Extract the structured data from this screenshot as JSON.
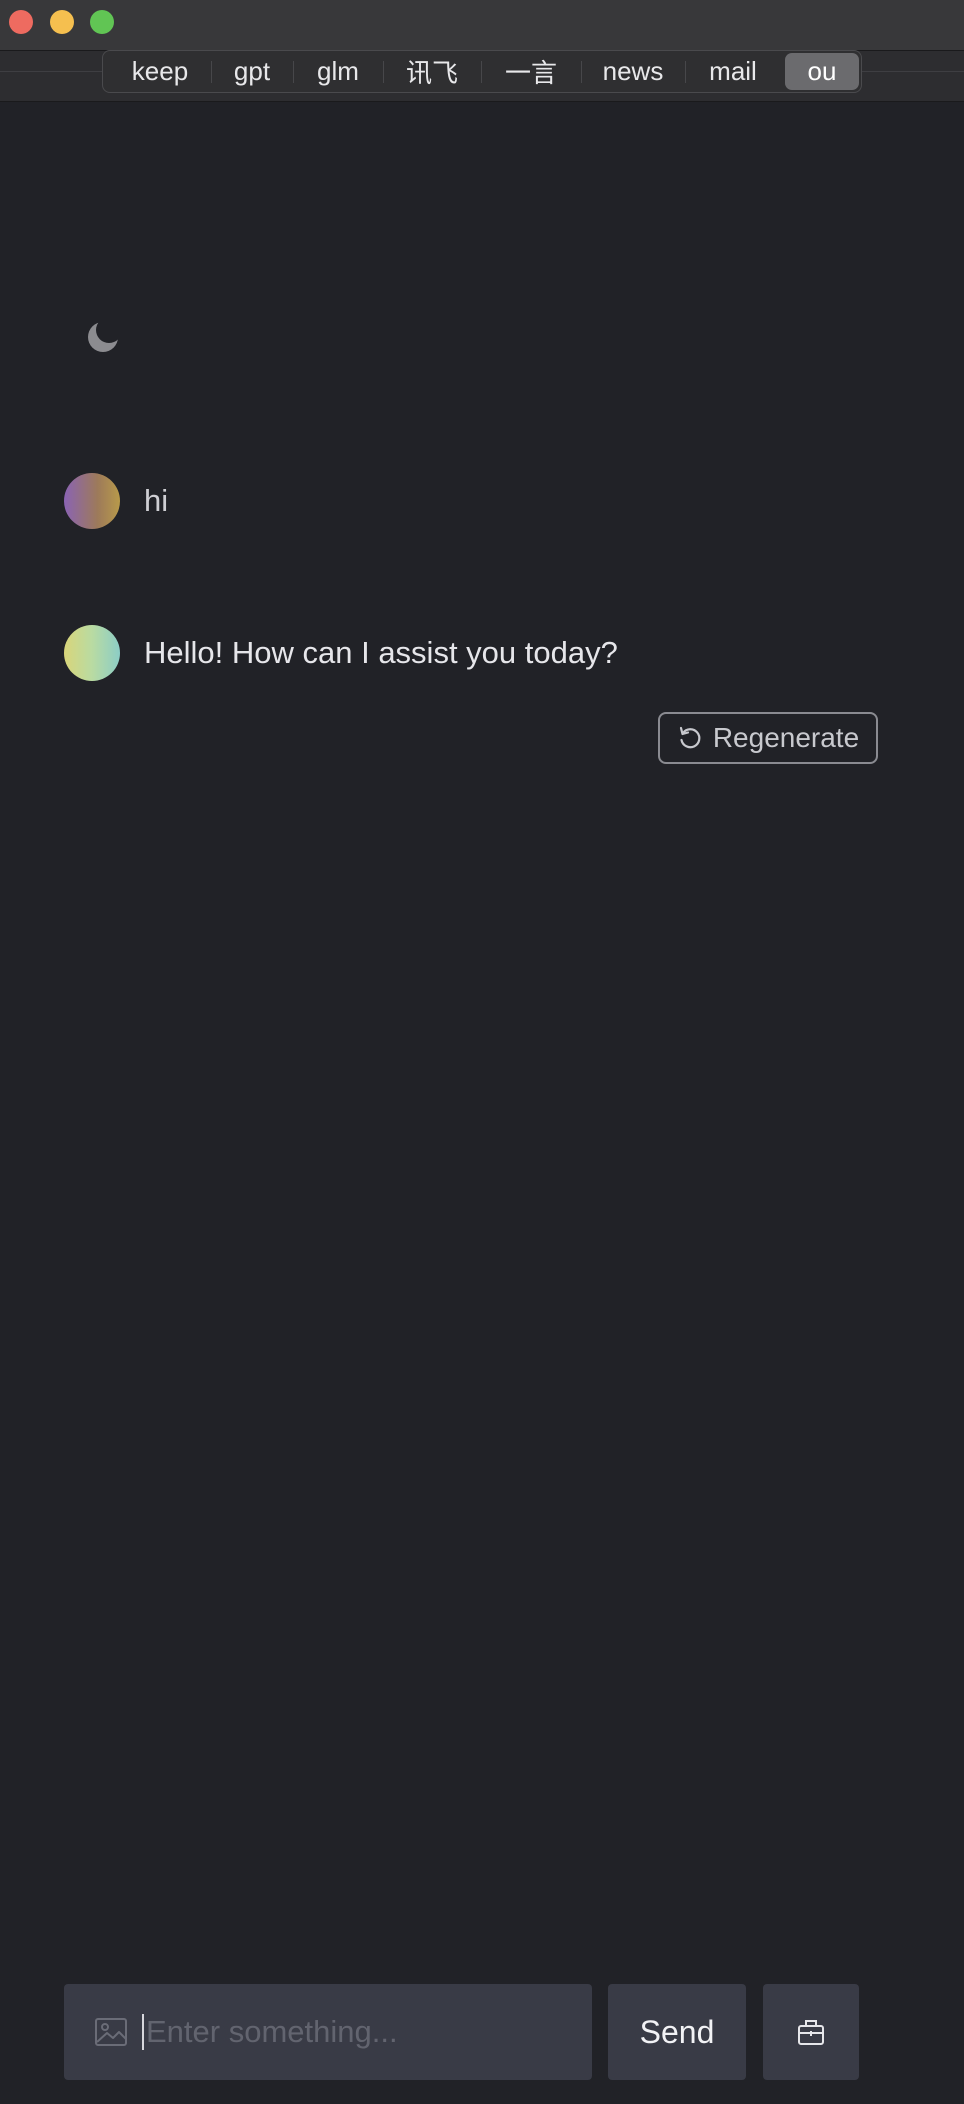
{
  "window": {
    "controls": [
      "close",
      "minimize",
      "zoom"
    ]
  },
  "tabs": {
    "items": [
      {
        "label": "keep",
        "active": false
      },
      {
        "label": "gpt",
        "active": false
      },
      {
        "label": "glm",
        "active": false
      },
      {
        "label": "讯飞",
        "active": false
      },
      {
        "label": "一言",
        "active": false
      },
      {
        "label": "news",
        "active": false
      },
      {
        "label": "mail",
        "active": false
      },
      {
        "label": "ou",
        "active": true
      }
    ]
  },
  "theme_toggle": {
    "icon": "moon-icon"
  },
  "conversation": {
    "messages": [
      {
        "role": "user",
        "text": "hi"
      },
      {
        "role": "assistant",
        "text": "Hello! How can I assist you today?"
      }
    ],
    "regenerate_label": "Regenerate"
  },
  "composer": {
    "value": "",
    "placeholder": "Enter something...",
    "send_label": "Send",
    "image_icon": "image-icon",
    "tool_icon": "toolbox-icon"
  },
  "colors": {
    "background": "#212227",
    "input_bg": "#393b46",
    "active_tab": "#6b6b6e"
  }
}
